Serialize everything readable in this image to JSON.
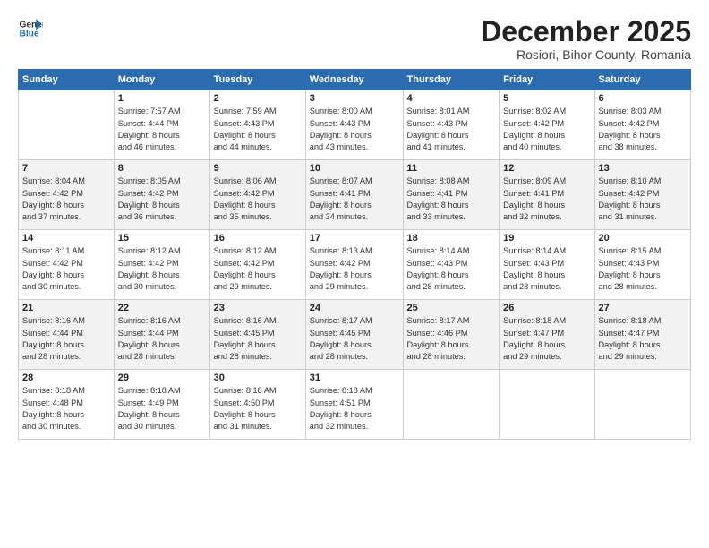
{
  "logo": {
    "line1": "General",
    "line2": "Blue"
  },
  "title": "December 2025",
  "subtitle": "Rosiori, Bihor County, Romania",
  "weekdays": [
    "Sunday",
    "Monday",
    "Tuesday",
    "Wednesday",
    "Thursday",
    "Friday",
    "Saturday"
  ],
  "weeks": [
    [
      {
        "day": "",
        "info": ""
      },
      {
        "day": "1",
        "info": "Sunrise: 7:57 AM\nSunset: 4:44 PM\nDaylight: 8 hours\nand 46 minutes."
      },
      {
        "day": "2",
        "info": "Sunrise: 7:59 AM\nSunset: 4:43 PM\nDaylight: 8 hours\nand 44 minutes."
      },
      {
        "day": "3",
        "info": "Sunrise: 8:00 AM\nSunset: 4:43 PM\nDaylight: 8 hours\nand 43 minutes."
      },
      {
        "day": "4",
        "info": "Sunrise: 8:01 AM\nSunset: 4:43 PM\nDaylight: 8 hours\nand 41 minutes."
      },
      {
        "day": "5",
        "info": "Sunrise: 8:02 AM\nSunset: 4:42 PM\nDaylight: 8 hours\nand 40 minutes."
      },
      {
        "day": "6",
        "info": "Sunrise: 8:03 AM\nSunset: 4:42 PM\nDaylight: 8 hours\nand 38 minutes."
      }
    ],
    [
      {
        "day": "7",
        "info": "Sunrise: 8:04 AM\nSunset: 4:42 PM\nDaylight: 8 hours\nand 37 minutes."
      },
      {
        "day": "8",
        "info": "Sunrise: 8:05 AM\nSunset: 4:42 PM\nDaylight: 8 hours\nand 36 minutes."
      },
      {
        "day": "9",
        "info": "Sunrise: 8:06 AM\nSunset: 4:42 PM\nDaylight: 8 hours\nand 35 minutes."
      },
      {
        "day": "10",
        "info": "Sunrise: 8:07 AM\nSunset: 4:41 PM\nDaylight: 8 hours\nand 34 minutes."
      },
      {
        "day": "11",
        "info": "Sunrise: 8:08 AM\nSunset: 4:41 PM\nDaylight: 8 hours\nand 33 minutes."
      },
      {
        "day": "12",
        "info": "Sunrise: 8:09 AM\nSunset: 4:41 PM\nDaylight: 8 hours\nand 32 minutes."
      },
      {
        "day": "13",
        "info": "Sunrise: 8:10 AM\nSunset: 4:42 PM\nDaylight: 8 hours\nand 31 minutes."
      }
    ],
    [
      {
        "day": "14",
        "info": "Sunrise: 8:11 AM\nSunset: 4:42 PM\nDaylight: 8 hours\nand 30 minutes."
      },
      {
        "day": "15",
        "info": "Sunrise: 8:12 AM\nSunset: 4:42 PM\nDaylight: 8 hours\nand 30 minutes."
      },
      {
        "day": "16",
        "info": "Sunrise: 8:12 AM\nSunset: 4:42 PM\nDaylight: 8 hours\nand 29 minutes."
      },
      {
        "day": "17",
        "info": "Sunrise: 8:13 AM\nSunset: 4:42 PM\nDaylight: 8 hours\nand 29 minutes."
      },
      {
        "day": "18",
        "info": "Sunrise: 8:14 AM\nSunset: 4:43 PM\nDaylight: 8 hours\nand 28 minutes."
      },
      {
        "day": "19",
        "info": "Sunrise: 8:14 AM\nSunset: 4:43 PM\nDaylight: 8 hours\nand 28 minutes."
      },
      {
        "day": "20",
        "info": "Sunrise: 8:15 AM\nSunset: 4:43 PM\nDaylight: 8 hours\nand 28 minutes."
      }
    ],
    [
      {
        "day": "21",
        "info": "Sunrise: 8:16 AM\nSunset: 4:44 PM\nDaylight: 8 hours\nand 28 minutes."
      },
      {
        "day": "22",
        "info": "Sunrise: 8:16 AM\nSunset: 4:44 PM\nDaylight: 8 hours\nand 28 minutes."
      },
      {
        "day": "23",
        "info": "Sunrise: 8:16 AM\nSunset: 4:45 PM\nDaylight: 8 hours\nand 28 minutes."
      },
      {
        "day": "24",
        "info": "Sunrise: 8:17 AM\nSunset: 4:45 PM\nDaylight: 8 hours\nand 28 minutes."
      },
      {
        "day": "25",
        "info": "Sunrise: 8:17 AM\nSunset: 4:46 PM\nDaylight: 8 hours\nand 28 minutes."
      },
      {
        "day": "26",
        "info": "Sunrise: 8:18 AM\nSunset: 4:47 PM\nDaylight: 8 hours\nand 29 minutes."
      },
      {
        "day": "27",
        "info": "Sunrise: 8:18 AM\nSunset: 4:47 PM\nDaylight: 8 hours\nand 29 minutes."
      }
    ],
    [
      {
        "day": "28",
        "info": "Sunrise: 8:18 AM\nSunset: 4:48 PM\nDaylight: 8 hours\nand 30 minutes."
      },
      {
        "day": "29",
        "info": "Sunrise: 8:18 AM\nSunset: 4:49 PM\nDaylight: 8 hours\nand 30 minutes."
      },
      {
        "day": "30",
        "info": "Sunrise: 8:18 AM\nSunset: 4:50 PM\nDaylight: 8 hours\nand 31 minutes."
      },
      {
        "day": "31",
        "info": "Sunrise: 8:18 AM\nSunset: 4:51 PM\nDaylight: 8 hours\nand 32 minutes."
      },
      {
        "day": "",
        "info": ""
      },
      {
        "day": "",
        "info": ""
      },
      {
        "day": "",
        "info": ""
      }
    ]
  ]
}
